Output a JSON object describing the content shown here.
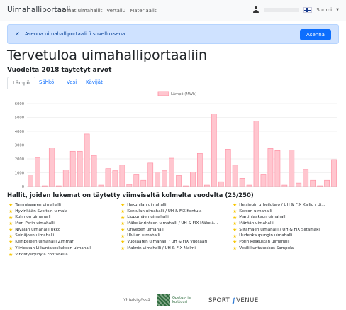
{
  "navbar": {
    "brand": "Uimahalliportaali",
    "links": [
      "Omat uimahallit",
      "Vertailu",
      "Materiaalit"
    ],
    "language": "Suomi"
  },
  "alert": {
    "close_symbol": "×",
    "text": "Asenna uimahalliportaali.fi sovelluksena",
    "button": "Asenna"
  },
  "page": {
    "title": "Tervetuloa uimahalliportaaliin",
    "subtitle": "Vuodelta 2018 täytetyt arvot"
  },
  "tabs": [
    "Lämpö",
    "Sähkö",
    "Vesi",
    "Kävijät"
  ],
  "chart_data": {
    "type": "bar",
    "legend": "Lämpö (MWh)",
    "ylim": [
      0,
      6000
    ],
    "yticks": [
      "0",
      "1000",
      "2000",
      "3000",
      "4000",
      "5000",
      "6000"
    ],
    "values": [
      850,
      2100,
      50,
      2800,
      50,
      1200,
      2550,
      2550,
      3800,
      2250,
      100,
      1300,
      1150,
      1550,
      150,
      900,
      450,
      1700,
      1050,
      1150,
      2050,
      800,
      50,
      1050,
      2400,
      100,
      5250,
      350,
      2700,
      1550,
      600,
      100,
      4750,
      900,
      2750,
      2600,
      100,
      2650,
      250,
      1250,
      450,
      50,
      450,
      1950
    ],
    "bar_color": "#ffc6cf",
    "bar_border": "#ff8ca0"
  },
  "hallit": {
    "title": "Hallit, joiden lukemat on täytetty viimeiseltä kolmelta vuodelta (25/250)",
    "col1": [
      "Tammisaaren uimahalli",
      "Hyvinkään Sveitsin uimala",
      "Kuhmon uimahalli",
      "Meri-Porin uimahalli",
      "Nivalan uimahalli Ukko",
      "Seinäjoen uimahalli",
      "Kempeleen uimahalli Zimmari",
      "Ylivieskan Liikuntakeskuksen uimahalli",
      "Virkistyskylpylä Fontanella"
    ],
    "col2": [
      "Hakunilan uimahalli",
      "Kontulan uimahalli / UH & FIX Kontula",
      "Lippumäen uimahalli",
      "Mäkelänrinteen uimahalli / UH & FIX Mäkelä...",
      "Oriveden uimahalli",
      "Ulvilan uimahalli",
      "Vuosaaren uimahalli / UH & FIX Vuosaari",
      "Malmin uimahalli / UH & FIX Malmi"
    ],
    "col3": [
      "Helsingin urheilutalo / UH & FIX Kallio / Ui...",
      "Korson uimahalli",
      "Martinlaakson uimahalli",
      "Mäntän uimahalli",
      "Siltamäen uimahalli / UH & FIX Siltamäki",
      "Uudenkaupungin uimahalli",
      "Porin keskustan uimahalli",
      "Vesiliikuntakeskus Sampola"
    ]
  },
  "footer": {
    "yhteistyossa": "Yhteistyössä",
    "opetus": "Opetus- ja kulttuuri",
    "sport": "SPORT",
    "venue": "VENUE"
  }
}
